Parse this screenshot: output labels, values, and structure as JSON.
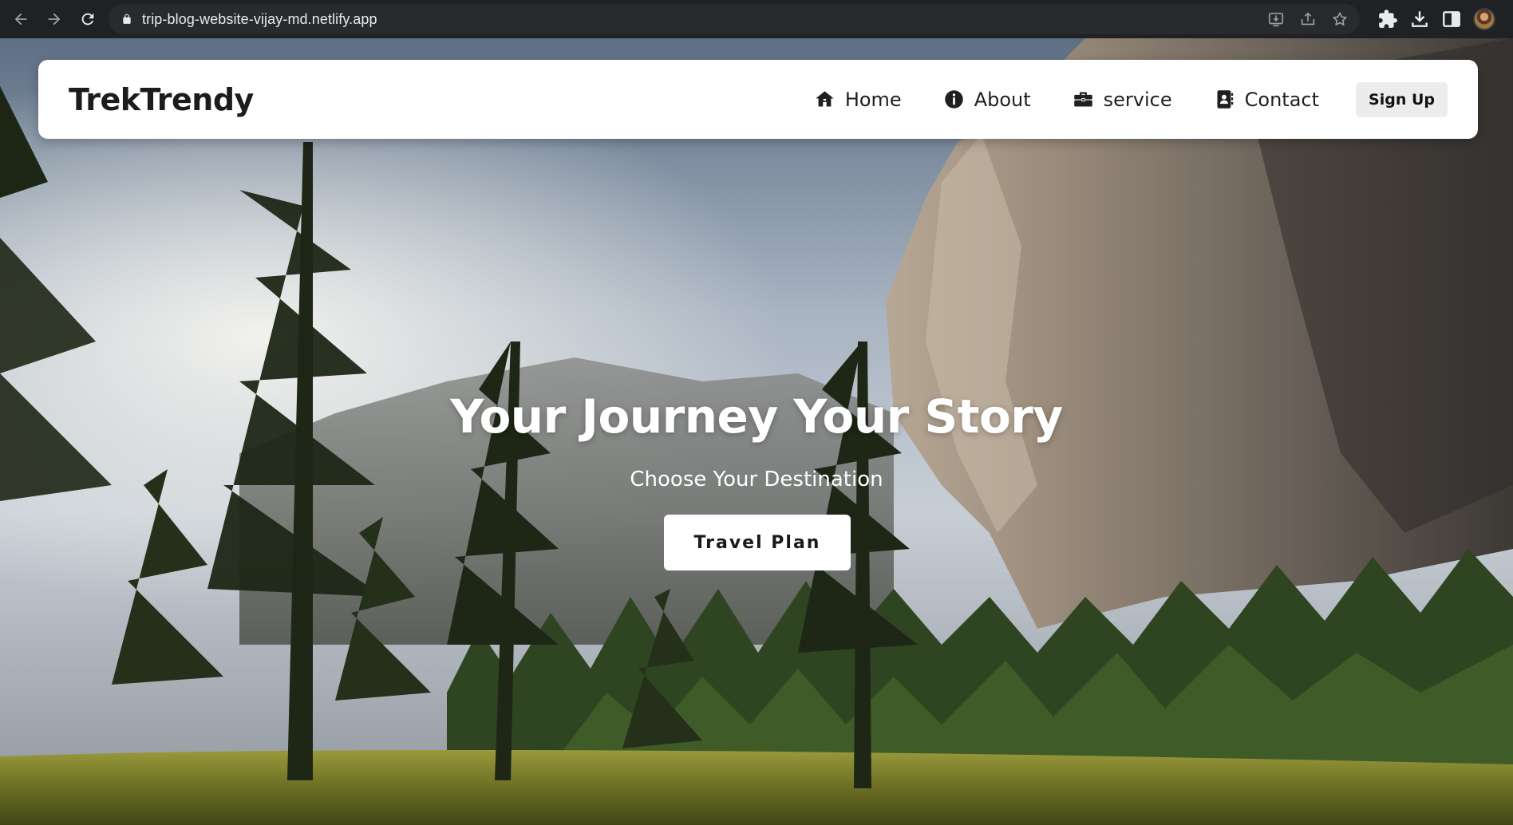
{
  "browser": {
    "url": "trip-blog-website-vijay-md.netlify.app",
    "nav_icons": [
      "back-arrow-icon",
      "forward-arrow-icon",
      "reload-icon"
    ],
    "address_icons": [
      "lock-icon",
      "install-app-icon",
      "share-icon",
      "star-icon"
    ],
    "toolbar_icons": [
      "extensions-icon",
      "download-icon",
      "side-panel-icon",
      "profile-avatar"
    ]
  },
  "navbar": {
    "brand": "TrekTrendy",
    "links": [
      {
        "label": "Home",
        "icon": "home-icon"
      },
      {
        "label": "About",
        "icon": "info-icon"
      },
      {
        "label": "service",
        "icon": "briefcase-icon"
      },
      {
        "label": "Contact",
        "icon": "contact-card-icon"
      }
    ],
    "signup_label": "Sign Up"
  },
  "hero": {
    "title": "Your Journey Your Story",
    "subtitle": "Choose Your Destination",
    "cta_label": "Travel Plan",
    "background": "mountain-forest-photo"
  },
  "colors": {
    "chrome_bg": "#202124",
    "address_bg": "#282a2d",
    "navbar_bg": "#ffffff",
    "signup_bg": "#ececec",
    "text_dark": "#1c1c1c"
  }
}
